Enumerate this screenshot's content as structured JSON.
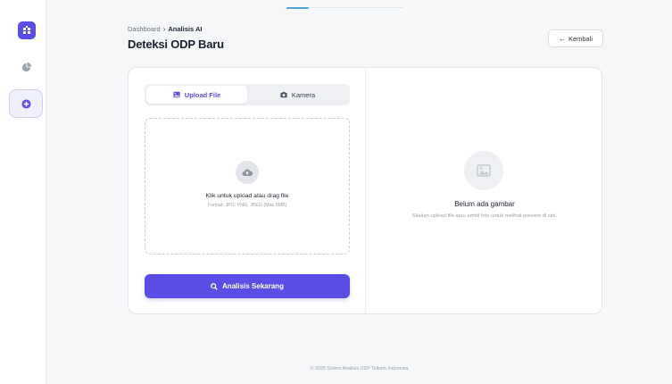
{
  "sidebar": {
    "logo_icon": "building-icon",
    "items": [
      {
        "icon": "pie-chart-icon",
        "active": false
      },
      {
        "icon": "plus-circle-icon",
        "active": true
      }
    ]
  },
  "header": {
    "breadcrumb": [
      "Dashboard",
      "Analisis AI"
    ],
    "title": "Deteksi ODP Baru",
    "back_label": "Kembali",
    "back_icon": "arrow-left-icon"
  },
  "upload": {
    "tabs": [
      {
        "label": "Upload File",
        "icon": "image-icon",
        "active": true
      },
      {
        "label": "Kamera",
        "icon": "camera-icon",
        "active": false
      }
    ],
    "dropzone_title": "Klik untuk upload atau drag file",
    "dropzone_formats": "Format: JPG, PNG, JPEG (Max 5MB)",
    "dropzone_icon": "cloud-upload-icon",
    "analyze_label": "Analisis Sekarang",
    "analyze_icon": "search-icon"
  },
  "preview": {
    "icon": "image-placeholder-icon",
    "title": "Belum ada gambar",
    "subtitle": "Silakan upload file atau ambil foto untuk melihat preview di sini."
  },
  "footer": {
    "text": "© 2025 Sistem Analisis ODP Telkom Indonesia"
  },
  "colors": {
    "accent": "#5b4ee6",
    "background": "#f6f7f9"
  }
}
